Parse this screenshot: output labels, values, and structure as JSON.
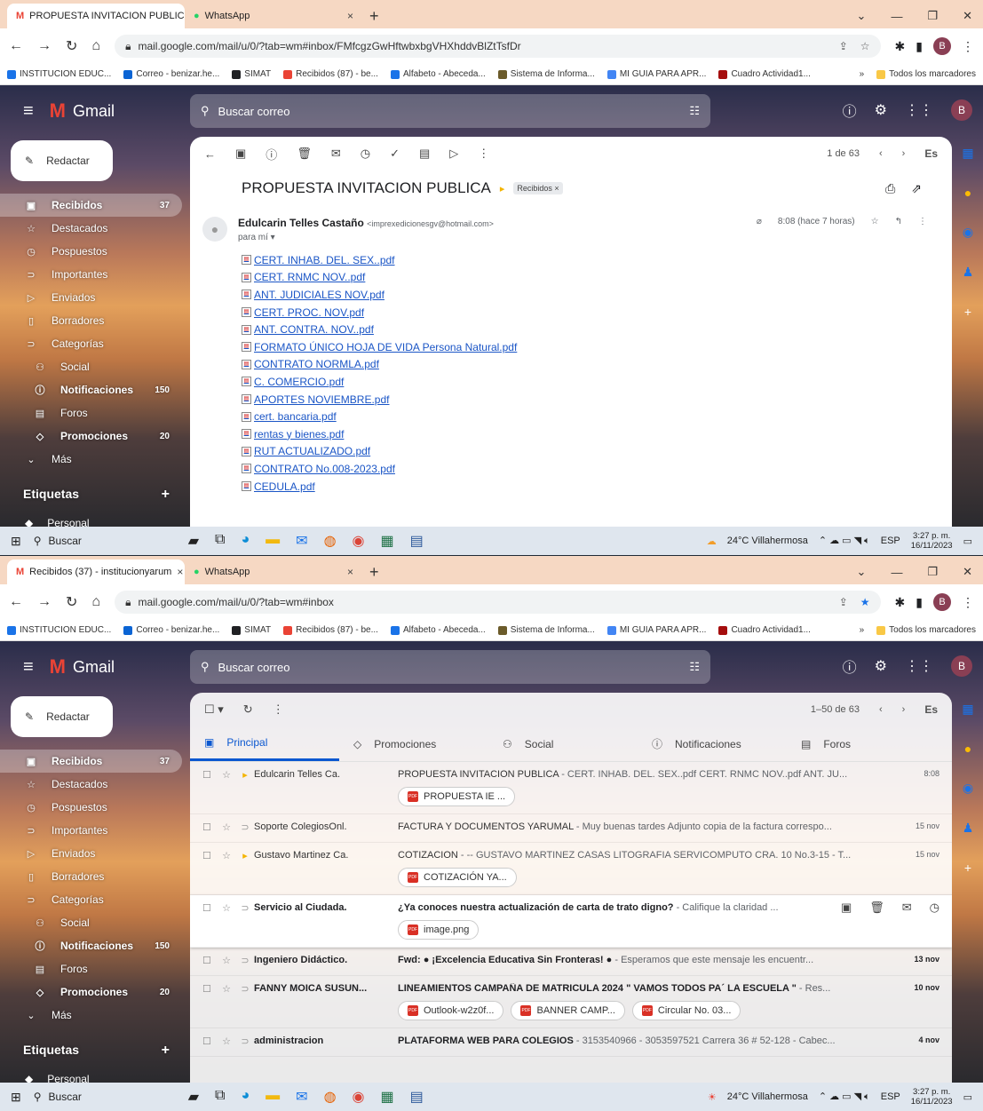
{
  "browser": {
    "tab_whatsapp": "WhatsApp",
    "tab_close": "×",
    "new_tab": "+",
    "bookmarks": [
      {
        "label": "INSTITUCION EDUC...",
        "color": "#1a73e8"
      },
      {
        "label": "Correo - benizar.he...",
        "color": "#0a64d4"
      },
      {
        "label": "SIMAT",
        "color": "#202124"
      },
      {
        "label": "Recibidos (87) - be...",
        "color": "#ea4335"
      },
      {
        "label": "Alfabeto - Abeceda...",
        "color": "#1a73e8"
      },
      {
        "label": "Sistema de Informa...",
        "color": "#6b5b2a"
      },
      {
        "label": "MI GUIA PARA APR...",
        "color": "#4285f4"
      },
      {
        "label": "Cuadro Actividad1...",
        "color": "#a50e0e"
      }
    ],
    "bookmarks_more": "»",
    "all_bookmarks": "Todos los marcadores",
    "profile_initial": "B"
  },
  "gmail": {
    "brand": "Gmail",
    "search_placeholder": "Buscar correo",
    "compose": "Redactar",
    "nav": [
      {
        "label": "Recibidos",
        "count": "37",
        "icon": "inbox-icon",
        "glyph": "▣"
      },
      {
        "label": "Destacados",
        "count": "",
        "icon": "star-icon",
        "glyph": "☆"
      },
      {
        "label": "Pospuestos",
        "count": "",
        "icon": "clock-icon",
        "glyph": "◷"
      },
      {
        "label": "Importantes",
        "count": "",
        "icon": "important-icon",
        "glyph": "⊃"
      },
      {
        "label": "Enviados",
        "count": "",
        "icon": "send-icon",
        "glyph": "▷"
      },
      {
        "label": "Borradores",
        "count": "",
        "icon": "draft-icon",
        "glyph": "▯"
      },
      {
        "label": "Categorías",
        "count": "",
        "icon": "label-icon",
        "glyph": "⊃"
      },
      {
        "label": "Social",
        "count": "",
        "icon": "people-icon",
        "glyph": "⚇"
      },
      {
        "label": "Notificaciones",
        "count": "150",
        "icon": "info-icon",
        "glyph": "ⓘ"
      },
      {
        "label": "Foros",
        "count": "",
        "icon": "forum-icon",
        "glyph": "▤"
      },
      {
        "label": "Promociones",
        "count": "20",
        "icon": "tag-icon",
        "glyph": "◇"
      },
      {
        "label": "Más",
        "count": "",
        "icon": "chevron-down-icon",
        "glyph": "⌄"
      }
    ],
    "labels_header": "Etiquetas",
    "labels_add": "+",
    "label_personal": "Personal"
  },
  "screen1": {
    "tab_title": "PROPUESTA INVITACION PUBLIC",
    "url": "mail.google.com/mail/u/0/?tab=wm#inbox/FMfcgzGwHftwbxbgVHXhddvBlZtTsfDr",
    "pager": "1 de 63",
    "lang": "Es",
    "subject": "PROPUESTA INVITACION PUBLICA",
    "label_chip": "Recibidos ×",
    "sender_name": "Edulcarin Telles Castaño",
    "sender_email": "<imprexedicionesgv@hotmail.com>",
    "to": "para mí ▾",
    "time": "8:08 (hace 7 horas)",
    "attachments": [
      "CERT. INHAB. DEL. SEX..pdf",
      "CERT. RNMC NOV..pdf",
      "ANT. JUDICIALES NOV.pdf",
      "CERT. PROC. NOV.pdf",
      "ANT. CONTRA. NOV..pdf",
      "FORMATO ÚNICO HOJA DE VIDA Persona Natural.pdf",
      "CONTRATO NORMLA.pdf",
      "C. COMERCIO.pdf",
      "APORTES NOVIEMBRE.pdf",
      "cert. bancaria.pdf",
      "rentas y bienes.pdf",
      "RUT ACTUALIZADO.pdf",
      "CONTRATO No.008-2023.pdf",
      "CEDULA.pdf"
    ]
  },
  "screen2": {
    "tab_title": "Recibidos (37) - institucionyarum",
    "url": "mail.google.com/mail/u/0/?tab=wm#inbox",
    "pager": "1–50 de 63",
    "lang": "Es",
    "tabs": [
      {
        "label": "Principal",
        "icon": "inbox-icon",
        "glyph": "▣"
      },
      {
        "label": "Promociones",
        "icon": "tag-icon",
        "glyph": "◇"
      },
      {
        "label": "Social",
        "icon": "people-icon",
        "glyph": "⚇"
      },
      {
        "label": "Notificaciones",
        "icon": "info-icon",
        "glyph": "ⓘ"
      },
      {
        "label": "Foros",
        "icon": "forum-icon",
        "glyph": "▤"
      }
    ],
    "rows": [
      {
        "from": "Edulcarin Telles Ca.",
        "subject": "PROPUESTA INVITACION PUBLICA",
        "snippet": " - CERT. INHAB. DEL. SEX..pdf CERT. RNMC NOV..pdf ANT. JU...",
        "date": "8:08",
        "chips": [
          "PROPUESTA IE ..."
        ],
        "bold": false,
        "imp": "▸"
      },
      {
        "from": "Soporte ColegiosOnl.",
        "subject": "FACTURA Y DOCUMENTOS YARUMAL",
        "snippet": " - Muy buenas tardes Adjunto copia de la factura correspo...",
        "date": "15 nov",
        "chips": [],
        "bold": false,
        "imp": "⊃"
      },
      {
        "from": "Gustavo Martinez Ca.",
        "subject": "COTIZACION",
        "snippet": " - -- GUSTAVO MARTINEZ CASAS LITOGRAFIA SERVICOMPUTO CRA. 10 No.3-15 - T...",
        "date": "15 nov",
        "chips": [
          "COTIZACIÓN YA..."
        ],
        "bold": false,
        "imp": "▸"
      },
      {
        "from": "Servicio al Ciudada.",
        "subject": "¿Ya conoces nuestra actualización de carta de trato digno?",
        "snippet": " - Califique la claridad ...",
        "date": "",
        "chips": [
          "image.png"
        ],
        "bold": true,
        "imp": "⊃"
      },
      {
        "from": "Ingeniero Didáctico.",
        "subject": "Fwd: ● ¡Excelencia Educativa Sin Fronteras! ●",
        "snippet": " - Esperamos que este mensaje les encuentr...",
        "date": "13 nov",
        "chips": [],
        "bold": true,
        "imp": "⊃"
      },
      {
        "from": "FANNY MOICA SUSUN...",
        "subject": "LINEAMIENTOS CAMPAÑA DE MATRICULA 2024 \" VAMOS TODOS PA´ LA ESCUELA \"",
        "snippet": " - Res...",
        "date": "10 nov",
        "chips": [
          "Outlook-w2z0f...",
          "BANNER CAMP...",
          "Circular No. 03..."
        ],
        "bold": true,
        "imp": "⊃"
      },
      {
        "from": "administracion",
        "subject": "PLATAFORMA WEB PARA COLEGIOS",
        "snippet": " - 3153540966 - 3053597521 Carrera 36 # 52-128 - Cabec...",
        "date": "4 nov",
        "chips": [],
        "bold": true,
        "imp": "⊃"
      }
    ]
  },
  "taskbar": {
    "search": "Buscar",
    "weather": "24°C Villahermosa",
    "lang": "ESP",
    "time": "3:27 p. m.",
    "date": "16/11/2023"
  }
}
